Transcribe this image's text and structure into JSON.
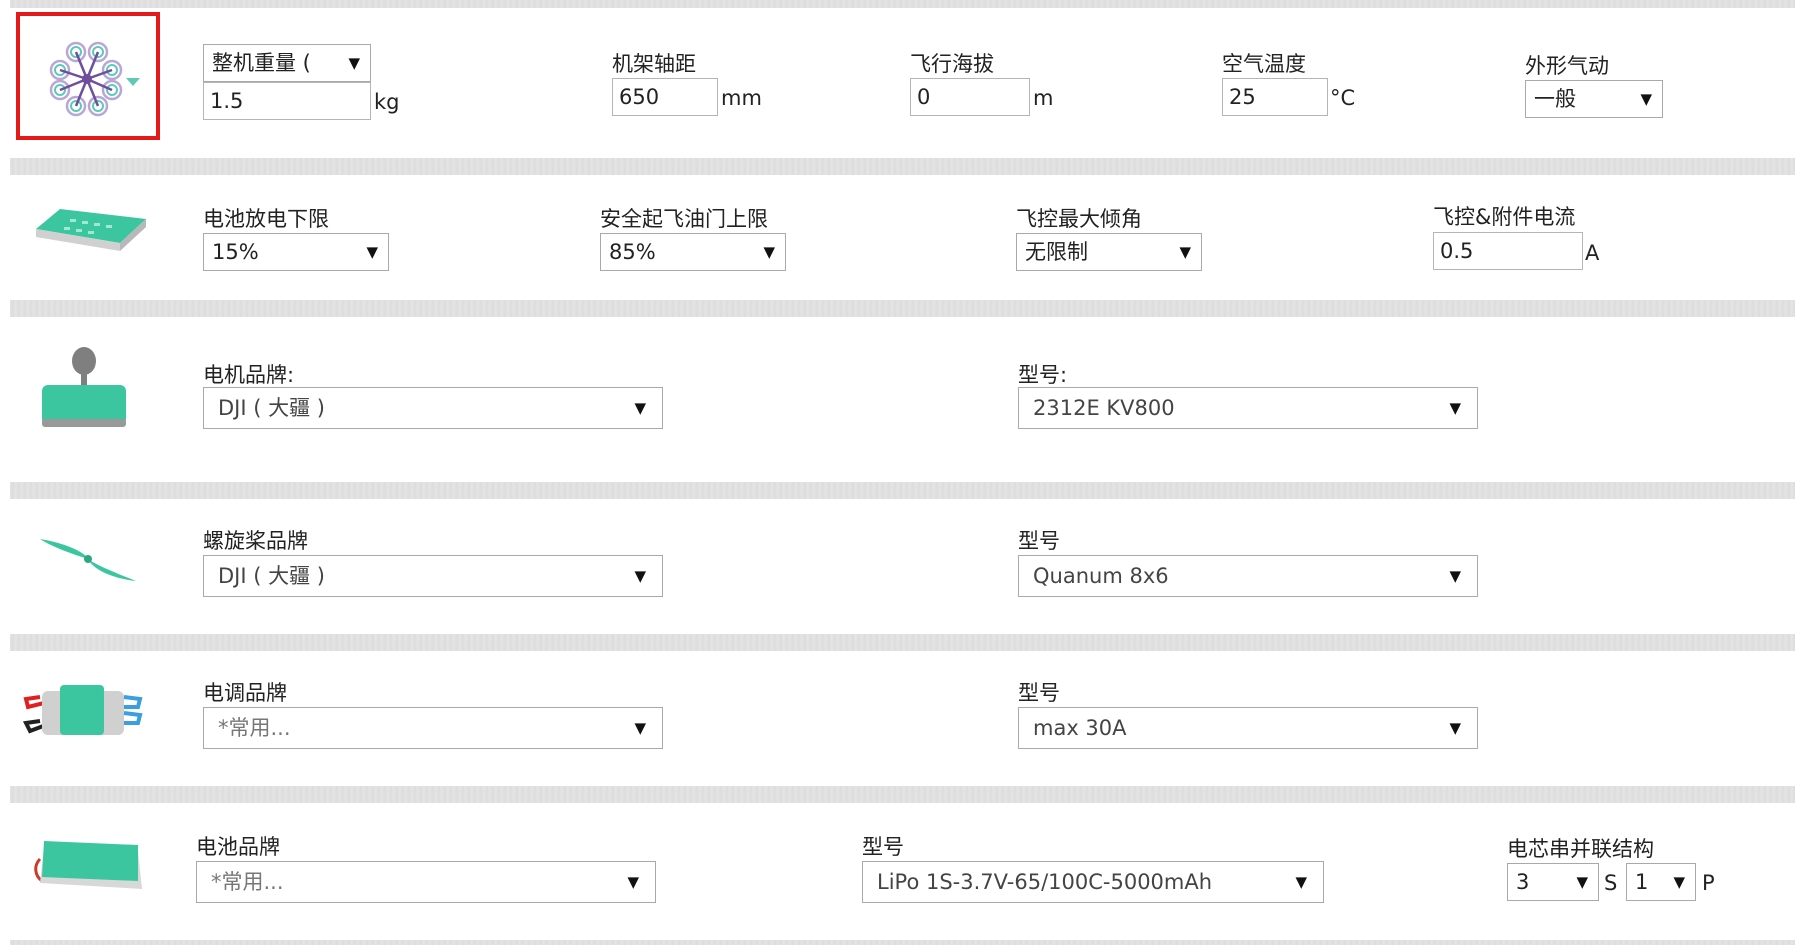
{
  "general": {
    "weight_select": "整机重量 (",
    "weight_value": "1.5",
    "weight_unit": "kg",
    "wheelbase_label": "机架轴距",
    "wheelbase_value": "650",
    "wheelbase_unit": "mm",
    "altitude_label": "飞行海拔",
    "altitude_value": "0",
    "altitude_unit": "m",
    "temperature_label": "空气温度",
    "temperature_value": "25",
    "temperature_unit": "°C",
    "aero_label": "外形气动",
    "aero_value": "一般"
  },
  "flight": {
    "discharge_label": "电池放电下限",
    "discharge_value": "15%",
    "throttle_label": "安全起飞油门上限",
    "throttle_value": "85%",
    "tilt_label": "飞控最大倾角",
    "tilt_value": "无限制",
    "current_label": "飞控&附件电流",
    "current_value": "0.5",
    "current_unit": "A"
  },
  "motor": {
    "brand_label": "电机品牌:",
    "brand_value": "DJI ( 大疆 )",
    "model_label": "型号:",
    "model_value": "2312E KV800"
  },
  "propeller": {
    "brand_label": "螺旋桨品牌",
    "brand_value": "DJI ( 大疆 )",
    "model_label": "型号",
    "model_value": "Quanum 8x6"
  },
  "esc": {
    "brand_label": "电调品牌",
    "brand_value": "*常用...",
    "model_label": "型号",
    "model_value": "max 30A"
  },
  "battery": {
    "brand_label": "电池品牌",
    "brand_value": "*常用...",
    "model_label": "型号",
    "model_value": "LiPo 1S-3.7V-65/100C-5000mAh",
    "cell_label": "电芯串并联结构",
    "series_value": "3",
    "series_unit": "S",
    "parallel_value": "1",
    "parallel_unit": "P"
  },
  "icons": {
    "frame": "octocopter-frame-icon",
    "flight_controller": "flight-controller-icon",
    "motor": "motor-icon",
    "propeller": "propeller-icon",
    "esc": "esc-icon",
    "battery": "battery-icon"
  },
  "colors": {
    "accent": "#3cc6a0",
    "highlight_border": "#e61919",
    "frame_arms": "#6d4f9e"
  },
  "dropdown_arrow": "▼"
}
